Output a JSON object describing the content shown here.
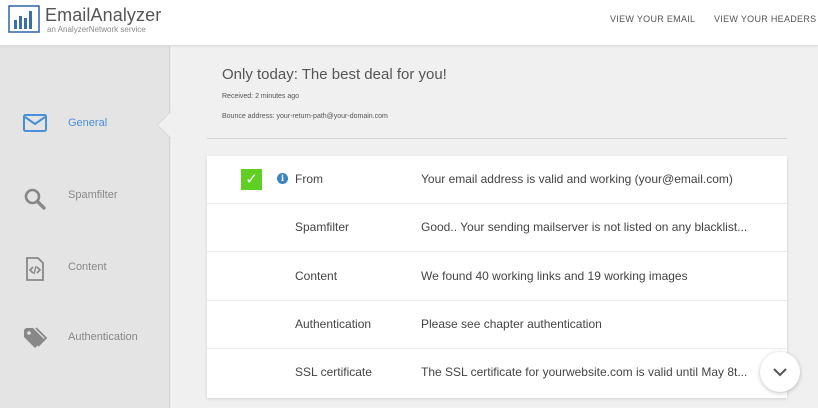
{
  "header": {
    "brand_name": "EmailAnalyzer",
    "brand_tagline": "an AnalyzerNetwork service",
    "nav": [
      {
        "label": "VIEW YOUR EMAIL"
      },
      {
        "label": "VIEW YOUR HEADERS"
      }
    ]
  },
  "sidebar": {
    "items": [
      {
        "label": "General",
        "icon": "envelope-icon",
        "active": true
      },
      {
        "label": "Spamfilter",
        "icon": "search-icon",
        "active": false
      },
      {
        "label": "Content",
        "icon": "code-file-icon",
        "active": false
      },
      {
        "label": "Authentication",
        "icon": "tag-icon",
        "active": false
      }
    ]
  },
  "email": {
    "subject": "Only today: The best deal for you!",
    "received": "Received: 2 minutes ago",
    "bounce": "Bounce address: your-return-path@your-domain.com"
  },
  "results": [
    {
      "label": "From",
      "value": "Your email address is valid and working (your@email.com)",
      "status": "valid",
      "check": "✓",
      "info": "i"
    },
    {
      "label": "Spamfilter",
      "value": "Good.. Your sending mailserver is not listed on any blacklist..."
    },
    {
      "label": "Content",
      "value": "We found 40 working links and 19 working images"
    },
    {
      "label": "Authentication",
      "value": "Please see chapter authentication"
    },
    {
      "label": "SSL certificate",
      "value": "The SSL certificate for yourwebsite.com is valid until May 8t..."
    }
  ],
  "colors": {
    "accent": "#4a8fd8",
    "check": "#5fd021",
    "info": "#3b82c4"
  }
}
